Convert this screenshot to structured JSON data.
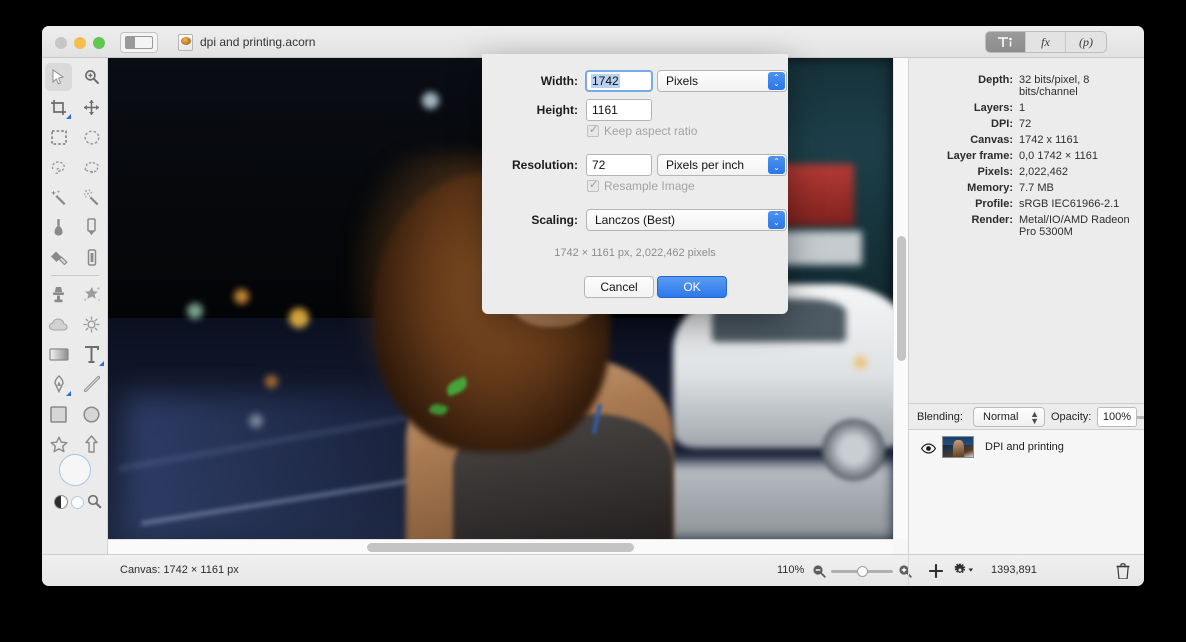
{
  "window": {
    "title": "dpi and printing.acorn",
    "traffic_lights": [
      "close",
      "minimize",
      "zoom"
    ],
    "sidebar_toggle_icon": "sidebar-toggle-icon",
    "document_icon": "acorn-document-icon"
  },
  "titlebar_segmented": {
    "tools_icon": "tools-inspector-icon",
    "fx_label": "fx",
    "presets_label": "(p)"
  },
  "tools": [
    {
      "name": "move-tool",
      "icon": "arrow-cursor-icon",
      "selected": true
    },
    {
      "name": "zoom-tool",
      "icon": "magnifier-plus-icon",
      "selected": false
    },
    {
      "name": "crop-tool",
      "icon": "crop-icon",
      "selected": false
    },
    {
      "name": "transform-tool",
      "icon": "move-arrows-icon",
      "selected": false
    },
    {
      "name": "rectangular-select-tool",
      "icon": "rectangle-marquee-icon",
      "selected": false
    },
    {
      "name": "elliptical-select-tool",
      "icon": "ellipse-marquee-icon",
      "selected": false
    },
    {
      "name": "lasso-tool",
      "icon": "lasso-icon",
      "selected": false
    },
    {
      "name": "polygon-lasso-tool",
      "icon": "polygon-lasso-icon",
      "selected": false
    },
    {
      "name": "magic-wand-tool",
      "icon": "magic-wand-icon",
      "selected": false
    },
    {
      "name": "instant-alpha-tool",
      "icon": "sparkle-wand-icon",
      "selected": false
    },
    {
      "name": "paint-bucket-tool",
      "icon": "paint-bucket-icon",
      "selected": false
    },
    {
      "name": "pencil-tool",
      "icon": "pencil-icon",
      "selected": false
    },
    {
      "name": "eraser-tool",
      "icon": "eraser-icon",
      "selected": false
    },
    {
      "name": "smudge-tool",
      "icon": "smudge-icon",
      "selected": false
    },
    {
      "name": "clone-stamp-tool",
      "icon": "clone-stamp-icon",
      "selected": false
    },
    {
      "name": "scatter-brush-tool",
      "icon": "scatter-splat-icon",
      "selected": false
    },
    {
      "name": "blur-tool",
      "icon": "cloud-blur-icon",
      "selected": false
    },
    {
      "name": "dodge-burn-tool",
      "icon": "sun-dodge-icon",
      "selected": false
    },
    {
      "name": "gradient-tool",
      "icon": "gradient-icon",
      "selected": false
    },
    {
      "name": "text-tool",
      "icon": "text-t-icon",
      "selected": false
    },
    {
      "name": "bezier-pen-tool",
      "icon": "pen-nib-icon",
      "selected": false
    },
    {
      "name": "line-tool",
      "icon": "line-icon",
      "selected": false
    },
    {
      "name": "rectangle-shape-tool",
      "icon": "square-shape-icon",
      "selected": false
    },
    {
      "name": "ellipse-shape-tool",
      "icon": "circle-shape-icon",
      "selected": false
    },
    {
      "name": "star-shape-tool",
      "icon": "star-shape-icon",
      "selected": false
    },
    {
      "name": "arrow-shape-tool",
      "icon": "arrow-shape-icon",
      "selected": false
    }
  ],
  "tool_extras": {
    "brush_size_well": "brush-size-well",
    "foreground_swatch": "foreground-color-swatch",
    "background_swatch": "background-color-swatch",
    "loupe_icon": "magnifier-icon"
  },
  "inspector": {
    "info_rows": [
      {
        "key": "Depth:",
        "value": "32 bits/pixel, 8 bits/channel"
      },
      {
        "key": "Layers:",
        "value": "1"
      },
      {
        "key": "DPI:",
        "value": "72"
      },
      {
        "key": "Canvas:",
        "value": "1742 x 1161"
      },
      {
        "key": "Layer frame:",
        "value": "0,0 1742 × 1161"
      },
      {
        "key": "Pixels:",
        "value": "2,022,462"
      },
      {
        "key": "Memory:",
        "value": "7.7 MB"
      },
      {
        "key": "Profile:",
        "value": "sRGB IEC61966-2.1"
      },
      {
        "key": "Render:",
        "value": "Metal/IO/AMD Radeon Pro 5300M"
      }
    ],
    "blending_label": "Blending:",
    "blending_value": "Normal",
    "opacity_label": "Opacity:",
    "opacity_value": "100%",
    "layers": [
      {
        "name": "DPI and printing",
        "visible": true
      }
    ]
  },
  "statusbar": {
    "canvas_status": "Canvas: 1742 × 1161 px",
    "zoom_percent": "110%",
    "zoom_out_icon": "zoom-out-icon",
    "zoom_in_icon": "zoom-in-icon",
    "add_layer_icon": "plus-icon",
    "layer_actions_icon": "gear-icon",
    "pointer_coords": "1393,891",
    "trash_icon": "trash-icon"
  },
  "dialog": {
    "width_label": "Width:",
    "width_value": "1742",
    "width_unit": "Pixels",
    "height_label": "Height:",
    "height_value": "1161",
    "keep_aspect_label": "Keep aspect ratio",
    "resolution_label": "Resolution:",
    "resolution_value": "72",
    "resolution_unit": "Pixels per inch",
    "resample_label": "Resample Image",
    "scaling_label": "Scaling:",
    "scaling_value": "Lanczos (Best)",
    "summary": "1742 × 1161 px, 2,022,462 pixels",
    "cancel_label": "Cancel",
    "ok_label": "OK"
  },
  "colors": {
    "accent_blue": "#2d78ea",
    "window_bg": "#ececec",
    "focus_ring": "#78a9e8"
  }
}
